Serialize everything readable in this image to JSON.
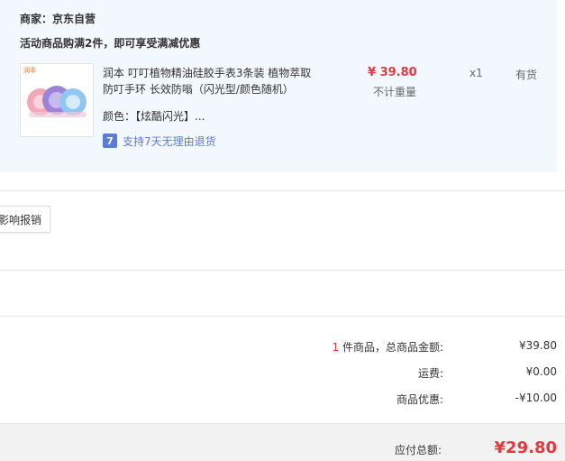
{
  "merchant": {
    "label": "商家：京东自营"
  },
  "promo": {
    "text": "活动商品购满2件，即可享受满减优惠"
  },
  "product": {
    "thumb_brand": "润本",
    "title": "润本 叮叮植物精油硅胶手表3条装 植物萃取防叮手环 长效防嗡（闪光型/颜色随机）",
    "color_label": "颜色：",
    "color_value": "【炫酷闪光】...",
    "return_icon_text": "7",
    "return_text": "支持7天无理由退货",
    "price": "¥ 39.80",
    "weight": "不计重量",
    "qty": "x1",
    "stock": "有货",
    "icons": [
      "thumbnail-image",
      "return-7day-icon"
    ]
  },
  "expense_button": {
    "label": "影响报销"
  },
  "summary": {
    "items_count": "1",
    "items_label": " 件商品，总商品金额:",
    "items_total": "¥39.80",
    "shipping_label": "运费:",
    "shipping_value": "¥0.00",
    "discount_label": "商品优惠:",
    "discount_value": "-¥10.00",
    "payable_label": "应付总额:",
    "payable_value": "¥29.80"
  },
  "colors": {
    "accent_red": "#e4393c",
    "link_blue": "#5a7bd6",
    "panel_bg": "#f3f8fe"
  }
}
